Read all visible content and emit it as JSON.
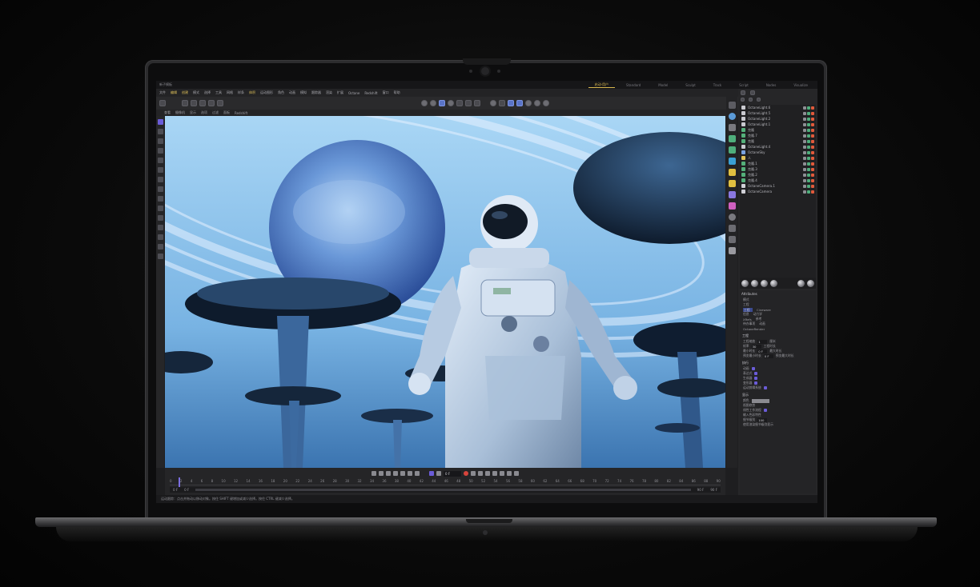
{
  "app": {
    "file_tab": "新子模板",
    "layout_tabs": [
      "启动-用户",
      "Standard",
      "Model",
      "Sculpt",
      "Track",
      "Script",
      "Nodes",
      "Visualize"
    ],
    "active_layout": 0
  },
  "menubar": {
    "items": [
      "文件",
      "编辑",
      "创建",
      "模式",
      "选择",
      "工具",
      "网格",
      "样条",
      "体积",
      "运动图形",
      "角色",
      "动画",
      "模拟",
      "跟踪器",
      "渲染",
      "扩展",
      "Octane",
      "Redshift",
      "窗口",
      "帮助"
    ],
    "highlight": [
      1,
      2,
      8
    ]
  },
  "viewport_menu": {
    "items": [
      "查看",
      "摄像机",
      "显示",
      "选项",
      "过滤",
      "面板",
      "Redshift"
    ]
  },
  "scene_objects": [
    {
      "label": "OctaneLight.6",
      "color": "#c9c9cf"
    },
    {
      "label": "OctaneLight.5",
      "color": "#c9c9cf"
    },
    {
      "label": "OctaneLight.2",
      "color": "#c9c9cf"
    },
    {
      "label": "OctaneLight.1",
      "color": "#c9c9cf"
    },
    {
      "label": "克隆",
      "color": "#54b07a"
    },
    {
      "label": "克隆.7",
      "color": "#54b07a"
    },
    {
      "label": "克隆",
      "color": "#54b07a"
    },
    {
      "label": "OctaneLight.4",
      "color": "#c9c9cf"
    },
    {
      "label": "OctaneSky",
      "color": "#7aa3e0"
    },
    {
      "label": "人",
      "color": "#e0c25a"
    },
    {
      "label": "克隆.1",
      "color": "#54b07a"
    },
    {
      "label": "克隆.3",
      "color": "#54b07a"
    },
    {
      "label": "克隆.2",
      "color": "#54b07a"
    },
    {
      "label": "克隆.4",
      "color": "#54b07a"
    },
    {
      "label": "OctaneCamera.1",
      "color": "#d0d0d6"
    },
    {
      "label": "OctaneCamera",
      "color": "#d0d0d6"
    }
  ],
  "attributes": {
    "tab": "Attributes",
    "mode": "模式",
    "object": "工程",
    "scene_sections": [
      "工程",
      "Cineware",
      "信息",
      "动力学",
      "XRefs",
      "参考",
      "待办事项",
      "动画",
      "OctaneRender"
    ],
    "project_header": "工程",
    "rows": [
      {
        "label": "工程缩放",
        "value": "1",
        "unit": "厘米"
      },
      {
        "label": "帧率",
        "value": "30",
        "extra": "工程时长"
      },
      {
        "label": "最小时长",
        "value": "0 F",
        "extra": "最大时长"
      },
      {
        "label": "预览最小时长",
        "value": "0 F",
        "extra": "预览最大时长"
      }
    ],
    "execute_header": "执行",
    "checks": [
      "动画",
      "表达式",
      "生成器",
      "变形器",
      "运动剪辑系统"
    ],
    "display_header": "显示",
    "display_rows": [
      "颜色",
      "视图修剪",
      "线性工作流程",
      "输入色彩特性"
    ],
    "lod_label": "细节级别",
    "lod_value": "100",
    "note": "使用渲染细节级别显示"
  },
  "timeline": {
    "frame_field": "0 F",
    "ticks": [
      "0",
      "2",
      "4",
      "6",
      "8",
      "10",
      "12",
      "14",
      "16",
      "18",
      "20",
      "22",
      "24",
      "26",
      "28",
      "30",
      "32",
      "34",
      "36",
      "38",
      "40",
      "42",
      "44",
      "46",
      "48",
      "50",
      "52",
      "54",
      "56",
      "58",
      "60",
      "62",
      "64",
      "66",
      "68",
      "70",
      "72",
      "74",
      "76",
      "78",
      "80",
      "82",
      "84",
      "86",
      "88",
      "90"
    ],
    "range_start": "0 F",
    "range_mid": "0 F",
    "range_end": "90 F",
    "range_end2": "90 F"
  },
  "status": {
    "text": "运动跟踪：点击并拖动以移动对象。按住 SHIFT 键增加或减少选择。按住 CTRL 键减少选择。"
  },
  "colors": {
    "accent": "#6b5cd8",
    "highlight": "#d9b84f",
    "record": "#d8443c"
  }
}
